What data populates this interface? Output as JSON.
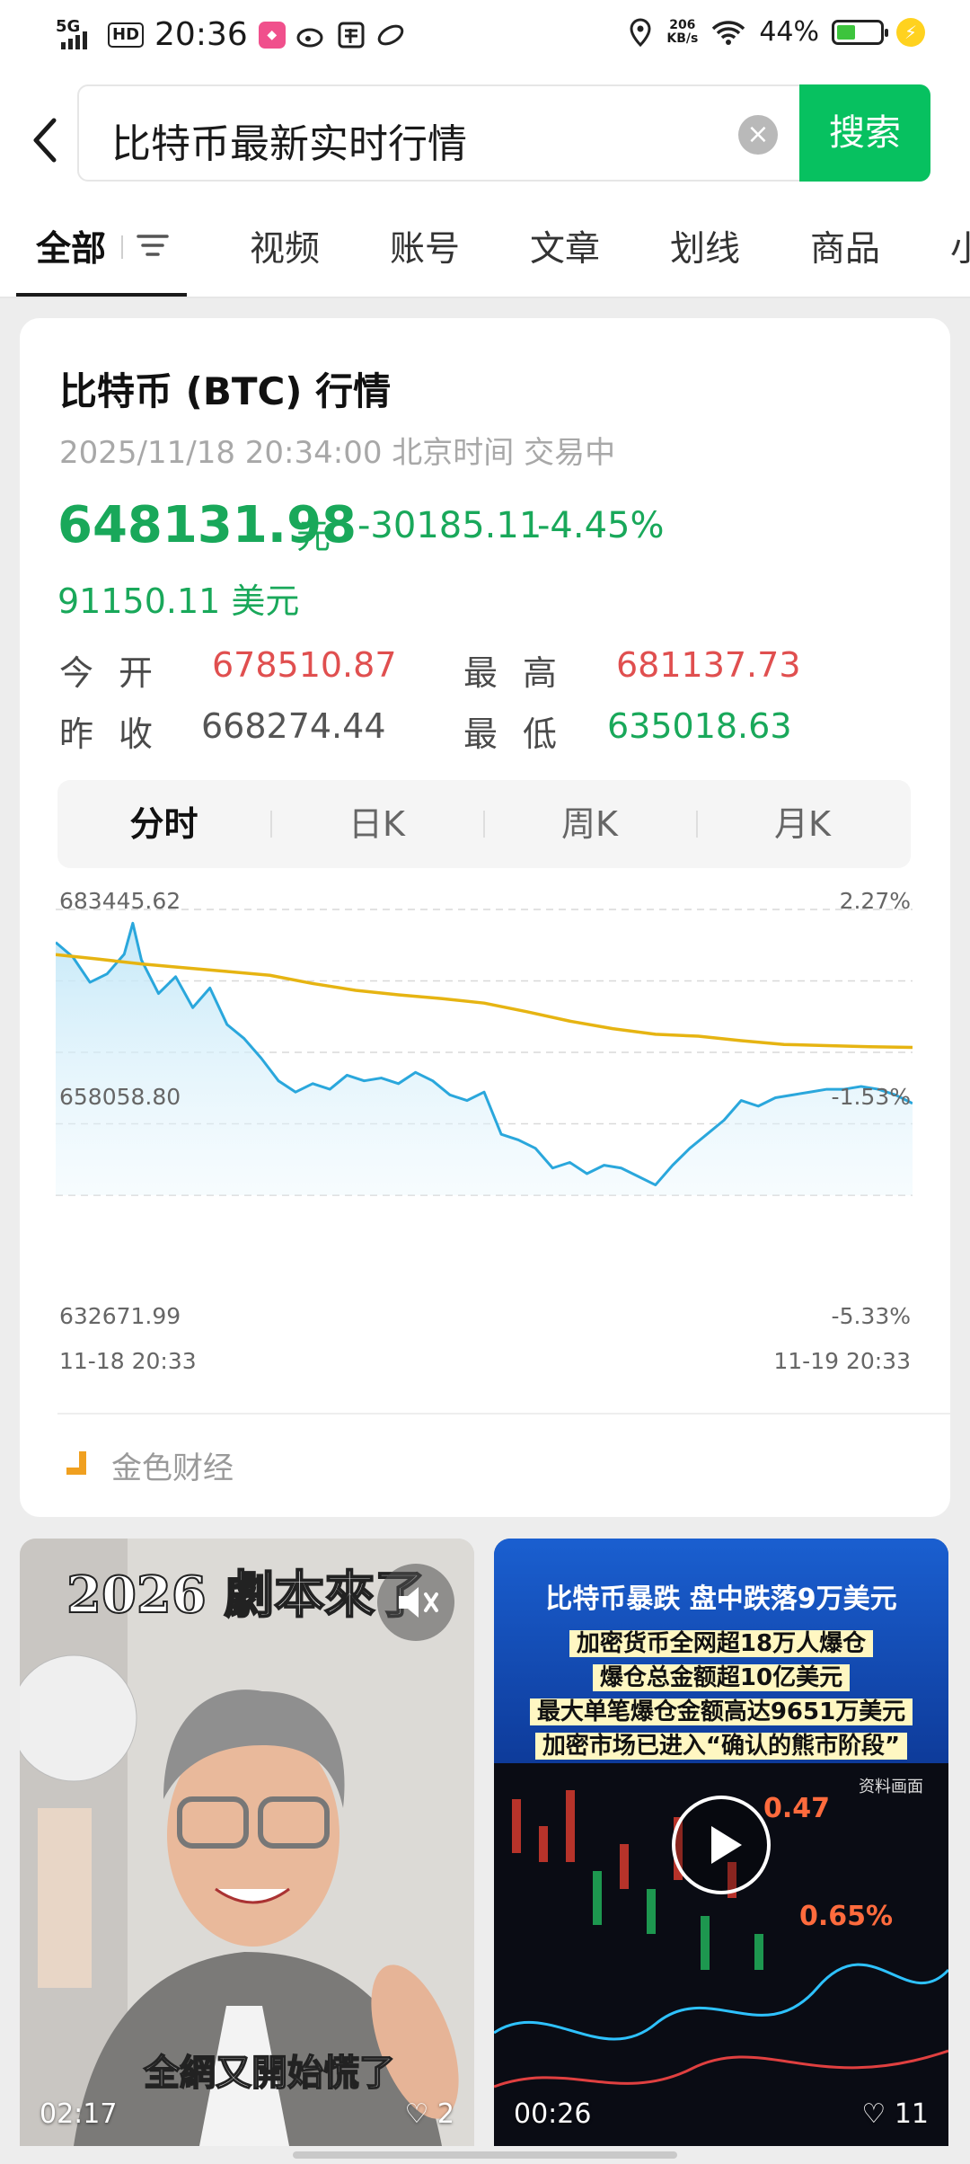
{
  "status_bar": {
    "network": "5G",
    "hd": "HD",
    "time": "20:36",
    "speed_value": "206",
    "speed_unit": "KB/s",
    "battery": "44%"
  },
  "search": {
    "query": "比特币最新实时行情",
    "button": "搜索"
  },
  "tabs": [
    "全部",
    "视频",
    "账号",
    "文章",
    "划线",
    "商品",
    "小"
  ],
  "card": {
    "title": "比特币 (BTC) 行情",
    "timestamp": "2025/11/18 20:34:00 北京时间 交易中",
    "price": "648131.98",
    "unit": "元",
    "change": "-30185.11",
    "change_pct": "-4.45%",
    "usd": "91150.11 美元",
    "stats": {
      "open_label": "今开",
      "open_value": "678510.87",
      "high_label": "最高",
      "high_value": "681137.73",
      "prev_close_label": "昨收",
      "prev_close_value": "668274.44",
      "low_label": "最低",
      "low_value": "635018.63"
    },
    "periods": [
      "分时",
      "日K",
      "周K",
      "月K"
    ],
    "source": "金色财经"
  },
  "chart_data": {
    "type": "line",
    "y_left_ticks": [
      "683445.62",
      "658058.80",
      "632671.99"
    ],
    "y_right_ticks": [
      "2.27%",
      "-1.53%",
      "-5.33%"
    ],
    "x_ticks": [
      "11-18 20:33",
      "11-19 20:33"
    ],
    "ylim": [
      632671.99,
      683445.62
    ],
    "grid": true,
    "series": [
      {
        "color": "#2aa7dc",
        "x": [
          0,
          2,
          4,
          6,
          8,
          9,
          10,
          12,
          14,
          16,
          18,
          20,
          22,
          24,
          26,
          28,
          30,
          32,
          34,
          36,
          38,
          40,
          42,
          44,
          46,
          48,
          50,
          52,
          54,
          56,
          58,
          60,
          62,
          64,
          66,
          68,
          70,
          72,
          74,
          76,
          78,
          80,
          82,
          84,
          86,
          88,
          90,
          92,
          94,
          96,
          98,
          100
        ],
        "values": [
          677600,
          675000,
          670500,
          672000,
          675500,
          681000,
          674500,
          668500,
          671500,
          666000,
          669500,
          663000,
          660500,
          657000,
          653000,
          651000,
          652500,
          651500,
          654000,
          653000,
          653500,
          652500,
          654500,
          653000,
          650500,
          649500,
          651000,
          643500,
          642500,
          641000,
          637500,
          638500,
          636500,
          638000,
          637500,
          636000,
          634500,
          638000,
          641000,
          643500,
          646000,
          649500,
          648500,
          650000,
          650500,
          651000,
          651500,
          651500,
          652000,
          651500,
          650500,
          649000
        ]
      },
      {
        "color": "#e6b412",
        "x": [
          0,
          5,
          10,
          15,
          20,
          25,
          30,
          35,
          40,
          45,
          50,
          55,
          60,
          65,
          70,
          75,
          80,
          85,
          90,
          95,
          100
        ],
        "values": [
          1.07,
          0.95,
          0.82,
          0.72,
          0.62,
          0.52,
          0.3,
          0.12,
          0.0,
          -0.1,
          -0.22,
          -0.45,
          -0.7,
          -0.9,
          -1.05,
          -1.1,
          -1.22,
          -1.32,
          -1.35,
          -1.38,
          -1.4
        ]
      }
    ]
  },
  "videos": [
    {
      "title_overlay": "2026  劇本來了",
      "subtitle": "全網又開始慌了",
      "duration": "02:17",
      "likes": "2"
    },
    {
      "headline": "比特币暴跌 盘中跌落9万美元",
      "line2": "加密货币全网超18万人爆仓",
      "line3": "爆仓总金额超10亿美元",
      "line4": "最大单笔爆仓金额高达9651万美元",
      "line5": "加密市场已进入“确认的熊市阶段”",
      "note": "资料画面",
      "duration": "00:26",
      "likes": "11"
    }
  ]
}
